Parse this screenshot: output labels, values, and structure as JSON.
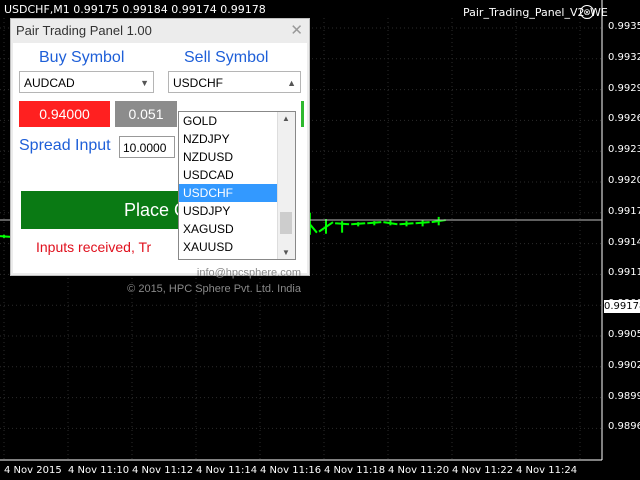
{
  "chart": {
    "title": "USDCHF,M1  0.99175 0.99184 0.99174 0.99178",
    "ea_name": "Pair_Trading_Panel_V2_WE",
    "close_symbol": "⊗",
    "current_price": "0.99178",
    "price_labels": [
      "0.99355",
      "0.99325",
      "0.99295",
      "0.99265",
      "0.99235",
      "0.99205",
      "0.99175",
      "0.99145",
      "0.99115",
      "0.99085",
      "0.99055",
      "0.99025",
      "0.98995",
      "0.98965"
    ],
    "time_labels": [
      "4 Nov 2015",
      "4 Nov 11:10",
      "4 Nov 11:12",
      "4 Nov 11:14",
      "4 Nov 11:16",
      "4 Nov 11:18",
      "4 Nov 11:20",
      "4 Nov 11:22",
      "4 Nov 11:24"
    ]
  },
  "chart_data": {
    "type": "candlestick",
    "symbol": "USDCHF",
    "timeframe": "M1",
    "candles": [
      {
        "o": 0.99163,
        "h": 0.99164,
        "l": 0.99161,
        "c": 0.99162
      },
      {
        "o": 0.99163,
        "h": 0.99165,
        "l": 0.99162,
        "c": 0.99164
      },
      {
        "o": 0.99164,
        "h": 0.99166,
        "l": 0.99163,
        "c": 0.99165
      },
      {
        "o": 0.99165,
        "h": 0.99185,
        "l": 0.99162,
        "c": 0.99184
      },
      {
        "o": 0.99184,
        "h": 0.99188,
        "l": 0.99181,
        "c": 0.99186
      },
      {
        "o": 0.99184,
        "h": 0.99196,
        "l": 0.99182,
        "c": 0.99186
      },
      {
        "o": 0.99186,
        "h": 0.99188,
        "l": 0.9917,
        "c": 0.99172
      },
      {
        "o": 0.99172,
        "h": 0.99174,
        "l": 0.99141,
        "c": 0.99143
      },
      {
        "o": 0.99143,
        "h": 0.99176,
        "l": 0.99141,
        "c": 0.99172
      },
      {
        "o": 0.99172,
        "h": 0.99174,
        "l": 0.99135,
        "c": 0.99137
      },
      {
        "o": 0.99137,
        "h": 0.99167,
        "l": 0.99128,
        "c": 0.99165
      },
      {
        "o": 0.9918,
        "h": 0.99203,
        "l": 0.99177,
        "c": 0.992
      },
      {
        "o": 0.99198,
        "h": 0.9921,
        "l": 0.99194,
        "c": 0.99196
      },
      {
        "o": 0.99196,
        "h": 0.99203,
        "l": 0.99185,
        "c": 0.99192
      },
      {
        "o": 0.99191,
        "h": 0.99193,
        "l": 0.99185,
        "c": 0.99187
      },
      {
        "o": 0.99188,
        "h": 0.9919,
        "l": 0.99186,
        "c": 0.99188
      },
      {
        "o": 0.99187,
        "h": 0.99191,
        "l": 0.99185,
        "c": 0.99186
      },
      {
        "o": 0.99186,
        "h": 0.99188,
        "l": 0.99163,
        "c": 0.99182
      },
      {
        "o": 0.99184,
        "h": 0.99186,
        "l": 0.99181,
        "c": 0.99183
      },
      {
        "o": 0.99182,
        "h": 0.99185,
        "l": 0.99164,
        "c": 0.99166
      },
      {
        "o": 0.99167,
        "h": 0.99179,
        "l": 0.99165,
        "c": 0.99176
      },
      {
        "o": 0.99175,
        "h": 0.99177,
        "l": 0.99166,
        "c": 0.99174
      },
      {
        "o": 0.99174,
        "h": 0.99176,
        "l": 0.99172,
        "c": 0.99175
      },
      {
        "o": 0.99175,
        "h": 0.99177,
        "l": 0.99173,
        "c": 0.99176
      },
      {
        "o": 0.99176,
        "h": 0.99178,
        "l": 0.99173,
        "c": 0.99174
      },
      {
        "o": 0.99174,
        "h": 0.99177,
        "l": 0.99172,
        "c": 0.99175
      },
      {
        "o": 0.99175,
        "h": 0.99178,
        "l": 0.99172,
        "c": 0.99176
      },
      {
        "o": 0.99176,
        "h": 0.99181,
        "l": 0.99173,
        "c": 0.99178
      }
    ],
    "ylim": [
      0.9895,
      0.9937
    ],
    "colors": {
      "candle": "#00ff00",
      "grid": "#2b2b2b",
      "current_line": "#c0c0c0"
    }
  },
  "panel": {
    "title": "Pair Trading Panel 1.00",
    "close_glyph": "✕",
    "buy_label": "Buy Symbol",
    "sell_label": "Sell Symbol",
    "buy_symbol": "AUDCAD",
    "sell_symbol": "USDCHF",
    "arrow_glyph": "▼",
    "sell_arrow_glyph": "▲",
    "buy_price": "0.94000",
    "sell_price": "0.051",
    "spread_label": "Spread Input",
    "spread_value": "10.0000",
    "place_label": "Place O",
    "message": "Inputs received, Tr",
    "email": "info@hpcsphere.com",
    "copyright": "© 2015, HPC Sphere Pvt. Ltd. India",
    "colors": {
      "buy_bg": "#ff2020",
      "sell_bg": "#8c8c8c",
      "place_bg": "#0a7a14",
      "label": "#1e5fd8",
      "message": "#e0101d"
    }
  },
  "dropdown": {
    "items": [
      "GOLD",
      "NZDJPY",
      "NZDUSD",
      "USDCAD",
      "USDCHF",
      "USDJPY",
      "XAGUSD",
      "XAUUSD"
    ],
    "selected_index": 4,
    "up_glyph": "▲",
    "down_glyph": "▼"
  }
}
